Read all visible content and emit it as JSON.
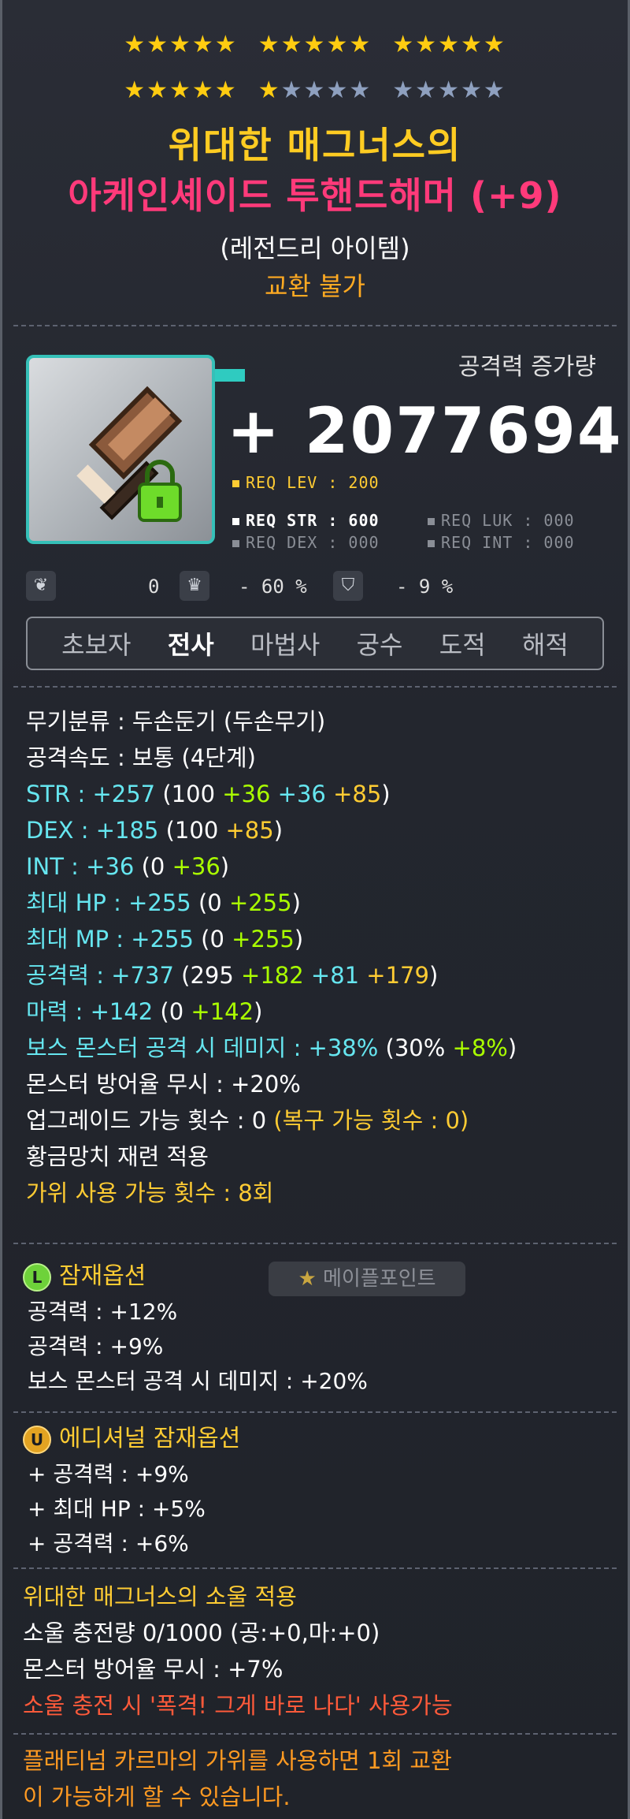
{
  "stars": {
    "filled": 21,
    "total": 30,
    "on_glyph": "★",
    "off_glyph": "★"
  },
  "item": {
    "prefix": "위대한 매그너스의",
    "name": "아케인셰이드 투핸드해머 (+9)",
    "grade": "(레전드리 아이템)",
    "tradable": "교환 불가"
  },
  "icon": {
    "name": "two-handed-hammer-icon",
    "lock": "lock-icon"
  },
  "attack_increase": {
    "label": "공격력 증가량",
    "value": "+ 2077694"
  },
  "requirements": {
    "lev": "REQ LEV : 200",
    "str": "REQ STR : 600",
    "luk": "REQ LUK : 000",
    "dex": "REQ DEX : 000",
    "int": "REQ INT : 000"
  },
  "small_stats": {
    "first": "0",
    "second": "- 60 %",
    "third": "- 9 %"
  },
  "classes": [
    "초보자",
    "전사",
    "마법사",
    "궁수",
    "도적",
    "해적"
  ],
  "active_class_index": 1,
  "stats": {
    "weapon_type": "무기분류 : 두손둔기 (두손무기)",
    "attack_speed": "공격속도 : 보통 (4단계)",
    "str": {
      "label": "STR : +257",
      "open": " (100 ",
      "a": "+36",
      "b": " +36",
      "c": " +85",
      "close": ")"
    },
    "dex": {
      "label": "DEX : +185",
      "open": " (100 ",
      "a": "+85",
      "close": ")"
    },
    "int": {
      "label": "INT : +36",
      "open": " (0 ",
      "a": "+36",
      "close": ")"
    },
    "hp": {
      "label": "최대 HP : +255",
      "open": " (0 ",
      "a": "+255",
      "close": ")"
    },
    "mp": {
      "label": "최대 MP : +255",
      "open": " (0 ",
      "a": "+255",
      "close": ")"
    },
    "atk": {
      "label": "공격력 : +737",
      "open": " (295 ",
      "a": "+182",
      "b": " +81",
      "c": " +179",
      "close": ")"
    },
    "magic": {
      "label": "마력 : +142",
      "open": " (0 ",
      "a": "+142",
      "close": ")"
    },
    "boss": {
      "label": "보스 몬스터 공격 시 데미지 : +38%",
      "open": " (30% ",
      "a": "+8%",
      "close": ")"
    },
    "ignore_def": "몬스터 방어율 무시 : +20%",
    "upgrades": {
      "label": "업그레이드 가능 횟수 : 0",
      "extra": " (복구 가능 횟수 : 0)"
    },
    "golden_hammer": "황금망치 재련 적용",
    "scissors": "가위 사용 가능 횟수 : 8회"
  },
  "potential": {
    "badge": "L",
    "title": "잠재옵션",
    "lines": [
      "공격력 : +12%",
      "공격력 : +9%",
      "보스 몬스터 공격 시 데미지 : +20%"
    ]
  },
  "maple_point_button": "메이플포인트",
  "additional_potential": {
    "badge": "U",
    "title": "에디셔널 잠재옵션",
    "lines": [
      "+ 공격력 : +9%",
      "+ 최대 HP : +5%",
      "+ 공격력 : +6%"
    ]
  },
  "soul": {
    "applied": "위대한 매그너스의 소울 적용",
    "charge": "소울 충전량 0/1000 (공:+0,마:+0)",
    "ignore_def": "몬스터 방어율 무시 : +7%",
    "skill": "소울 충전 시 '폭격! 그게 바로 나다' 사용가능"
  },
  "karma": {
    "line1": "플래티넘 카르마의 가위를 사용하면 1회 교환",
    "line2": "이 가능하게 할 수 있습니다."
  },
  "colors": {
    "prefix": "#ffcc22",
    "name": "#ff3a7a",
    "accent_teal": "#35c0b8",
    "stat_cyan": "#66e6f0",
    "bonus_green": "#aaff00",
    "bonus_yellow": "#ffcc33",
    "warn_red": "#ff5a3a"
  }
}
